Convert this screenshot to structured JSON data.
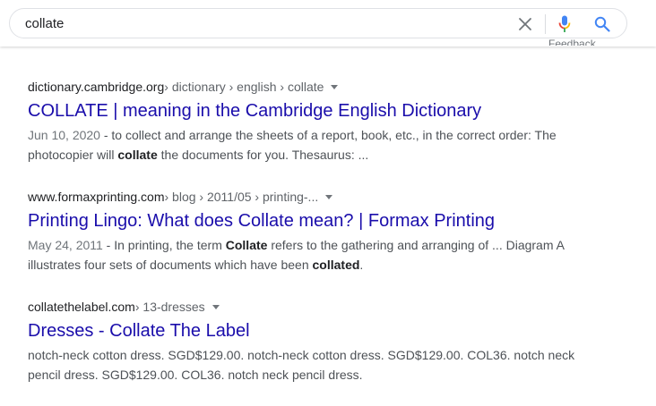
{
  "search": {
    "query": "collate",
    "feedback_label": "Feedback"
  },
  "results": [
    {
      "site": "dictionary.cambridge.org",
      "path": " › dictionary › english › collate",
      "title": "COLLATE | meaning in the Cambridge English Dictionary",
      "date": "Jun 10, 2020",
      "snippet": [
        {
          "t": " - to collect and arrange the sheets of a report, book, etc., in the correct order: The photocopier will "
        },
        {
          "t": "collate",
          "b": true
        },
        {
          "t": " the documents for you. Thesaurus: ..."
        }
      ]
    },
    {
      "site": "www.formaxprinting.com",
      "path": " › blog › 2011/05 › printing-...",
      "title": "Printing Lingo: What does Collate mean? | Formax Printing",
      "date": "May 24, 2011",
      "snippet": [
        {
          "t": " - In printing, the term "
        },
        {
          "t": "Collate",
          "b": true
        },
        {
          "t": " refers to the gathering and arranging of ... Diagram A illustrates four sets of documents which have been "
        },
        {
          "t": "collated",
          "b": true
        },
        {
          "t": "."
        }
      ]
    },
    {
      "site": "collatethelabel.com",
      "path": " › 13-dresses",
      "title": "Dresses - Collate The Label",
      "date": "",
      "snippet": [
        {
          "t": "notch-neck cotton dress. SGD$129.00. notch-neck cotton dress. SGD$129.00. COL36. notch neck pencil dress. SGD$129.00. COL36. notch neck pencil dress."
        }
      ]
    }
  ],
  "colors": {
    "link": "#1a0dab",
    "snippet": "#4d5156",
    "mic_blue": "#4285f4",
    "mic_red": "#ea4335",
    "mic_yellow": "#fbbc04",
    "mic_green": "#34a853"
  },
  "icons": [
    "close-icon",
    "microphone-icon",
    "search-icon",
    "chevron-down-icon"
  ]
}
